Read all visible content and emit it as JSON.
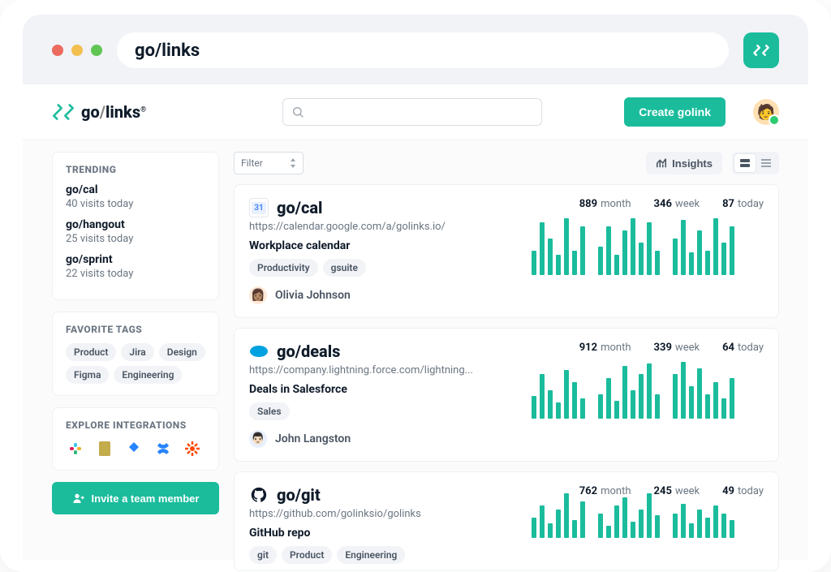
{
  "address_bar": {
    "text": "go/links"
  },
  "brand": {
    "pre": "go",
    "slash": "/",
    "post": "links",
    "reg": "®"
  },
  "header": {
    "create_btn": "Create golink"
  },
  "sidebar": {
    "trending_header": "TRENDING",
    "trending": [
      {
        "name": "go/cal",
        "visits": "40 visits today"
      },
      {
        "name": "go/hangout",
        "visits": "25 visits today"
      },
      {
        "name": "go/sprint",
        "visits": "22 visits today"
      }
    ],
    "fav_tags_header": "FAVORITE TAGS",
    "fav_tags": [
      "Product",
      "Jira",
      "Design",
      "Figma",
      "Engineering"
    ],
    "explore_header": "EXPLORE INTEGRATIONS",
    "invite_btn": "Invite a team member"
  },
  "toolbar": {
    "filter_label": "Filter",
    "insights_label": "Insights"
  },
  "links": [
    {
      "title": "go/cal",
      "url": "https://calendar.google.com/a/golinks.io/",
      "desc": "Workplace calendar",
      "tags": [
        "Productivity",
        "gsuite"
      ],
      "owner": "Olivia Johnson",
      "stats": {
        "month": 889,
        "week": 346,
        "today": 87
      }
    },
    {
      "title": "go/deals",
      "url": "https://company.lightning.force.com/lightning...",
      "desc": "Deals in Salesforce",
      "tags": [
        "Sales"
      ],
      "owner": "John Langston",
      "stats": {
        "month": 912,
        "week": 339,
        "today": 64
      }
    },
    {
      "title": "go/git",
      "url": "https://github.com/golinksio/golinks",
      "desc": "GitHub repo",
      "tags": [
        "git",
        "Product",
        "Engineering"
      ],
      "owner": "",
      "stats": {
        "month": 762,
        "week": 245,
        "today": 49
      }
    }
  ],
  "stat_labels": {
    "month": "month",
    "week": "week",
    "today": "today"
  }
}
